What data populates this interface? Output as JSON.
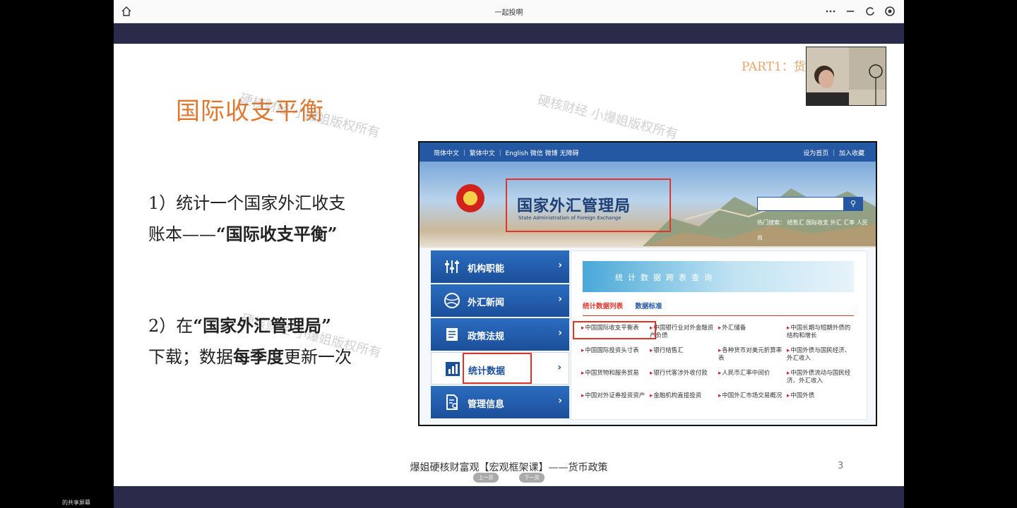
{
  "window": {
    "title": "一起投啊"
  },
  "slide": {
    "part_label": "PART1：货",
    "title": "国际收支平衡",
    "watermark": "硬核财经 小爆姐版权所有",
    "p1_line1": "1）统计一个国家外汇收支",
    "p1_line2_pre": "账本——",
    "p1_line2_bold": "“国际收支平衡”",
    "p2_line1_pre": "2）在",
    "p2_line1_bold": "“国家外汇管理局”",
    "p2_line2_pre": "下载；数据",
    "p2_line2_bold": "每季度",
    "p2_line2_post": "更新一次",
    "footer": "爆姐硬核财富观【宏观框架课】——货币政策",
    "page_number": "3",
    "prev_btn": "上一页",
    "next_btn": "下一页"
  },
  "website": {
    "top_left": "简体中文 ｜ 繁体中文 ｜ English  微信  微博  无障碍",
    "top_right": "设为首页  ｜  加入收藏",
    "org_cn": "国家外汇管理局",
    "org_en": "State Administration of Foreign Exchange",
    "search_icon": "search-icon",
    "hot_search": "热门搜索： 结售汇  国际收支  外汇  汇率  人民币",
    "nav": [
      {
        "label": "机构职能",
        "icon": "sliders-icon"
      },
      {
        "label": "外汇新闻",
        "icon": "globe-icon"
      },
      {
        "label": "政策法规",
        "icon": "document-icon"
      },
      {
        "label": "统计数据",
        "icon": "bar-chart-icon"
      },
      {
        "label": "管理信息",
        "icon": "file-settings-icon"
      }
    ],
    "banner": "统计数据跨表查询",
    "tab_list": "统计数据列表",
    "tab_standard": "数据标准",
    "links": [
      "中国国际收支平衡表",
      "中国银行业对外金融资产负债",
      "外汇储备",
      "中国长期与短期外债的结构和增长",
      "中国国际投资头寸表",
      "银行结售汇",
      "各种货币对美元折算率表",
      "中国外债与国民经济、外汇收入",
      "中国货物和服务贸易",
      "银行代客涉外收付款",
      "人民币汇率中间价",
      "中国外债流动与国民经济、外汇收入",
      "中国对外证券投资资产",
      "金融机构直接投资",
      "中国外汇市场交易概况",
      "中国外债"
    ]
  },
  "taskbar": {
    "share_label": "的共享屏幕"
  }
}
